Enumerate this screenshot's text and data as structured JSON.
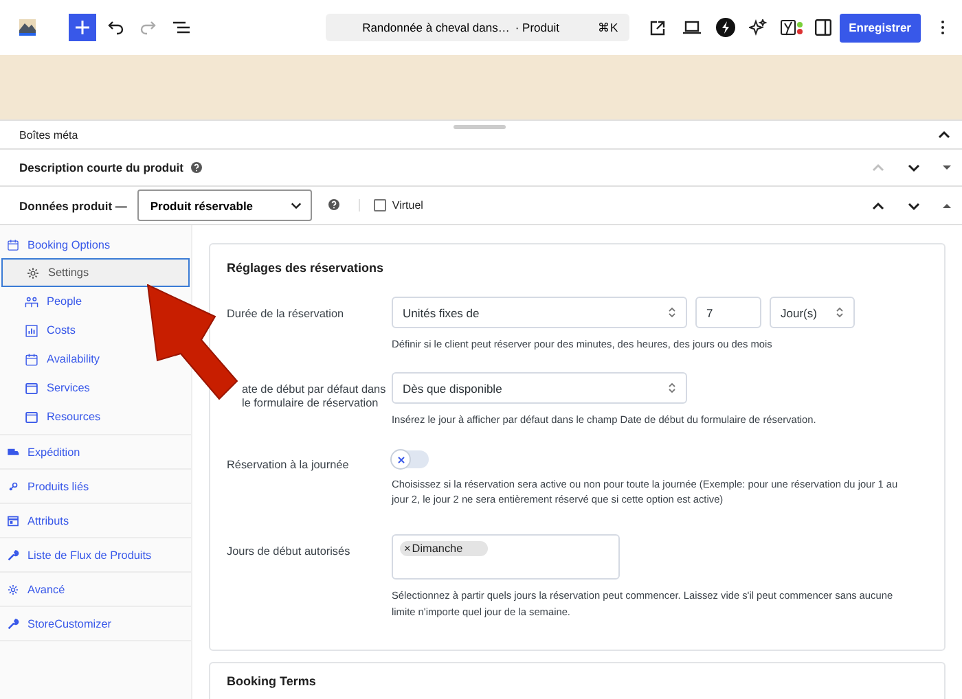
{
  "toolbar": {
    "document_title": "Randonnée à cheval dans…",
    "post_type": "· Produit",
    "shortcut": "⌘K",
    "save_button": "Enregistrer",
    "redo_disabled": true
  },
  "meta_boxes": {
    "title": "Boîtes méta",
    "expanded": true
  },
  "panels": [
    {
      "kind": "plain",
      "title": "Description courte du produit",
      "expanded": false,
      "can_move_up": false
    },
    {
      "kind": "product_data",
      "title": "Données produit —",
      "product_type": "Produit réservable",
      "virtual": {
        "label": "Virtuel",
        "checked": false
      },
      "expanded": true,
      "can_move_up": true
    }
  ],
  "tabs": [
    {
      "label": "Booking Options",
      "selected": false,
      "children": [
        {
          "label": "Settings",
          "selected": true
        },
        {
          "label": "People",
          "selected": false
        },
        {
          "label": "Costs",
          "selected": false
        },
        {
          "label": "Availability",
          "selected": false
        },
        {
          "label": "Services",
          "selected": false
        },
        {
          "label": "Resources",
          "selected": false
        }
      ]
    },
    {
      "label": "Expédition",
      "selected": false
    },
    {
      "label": "Produits liés",
      "selected": false
    },
    {
      "label": "Attributs",
      "selected": false
    },
    {
      "label": "Liste de Flux de Produits",
      "selected": false
    },
    {
      "label": "Avancé",
      "selected": false
    },
    {
      "label": "StoreCustomizer",
      "selected": false
    }
  ],
  "settings": {
    "title": "Réglages des réservations",
    "fields": [
      {
        "kind": "duration",
        "label": "Durée de la réservation",
        "type": "Unités fixes de",
        "value": "7",
        "unit": "Jour(s)",
        "help": "Définir si le client peut réserver pour des minutes, des heures, des jours ou des mois"
      },
      {
        "kind": "select",
        "label": "ate de début par défaut dans le formulaire de réservation",
        "value": "Dès que disponible",
        "help": "Insérez le jour à afficher par défaut dans le champ Date de début du formulaire de réservation."
      },
      {
        "kind": "toggle",
        "label": "Réservation à la journée",
        "on": false,
        "help": "Choisissez si la réservation sera active ou non pour toute la journée (Exemple: pour une réservation du jour 1 au jour 2, le jour 2 ne sera entièrement réservé que si cette option est active)"
      },
      {
        "kind": "tags",
        "label": "Jours de début autorisés",
        "tags": [
          {
            "remove": "×",
            "label": "Dimanche"
          }
        ],
        "help": "Sélectionnez à partir quels jours la réservation peut commencer. Laissez vide s'il peut commencer sans aucune limite n'importe quel jour de la semaine."
      }
    ]
  },
  "next_card": {
    "title": "Booking Terms"
  }
}
